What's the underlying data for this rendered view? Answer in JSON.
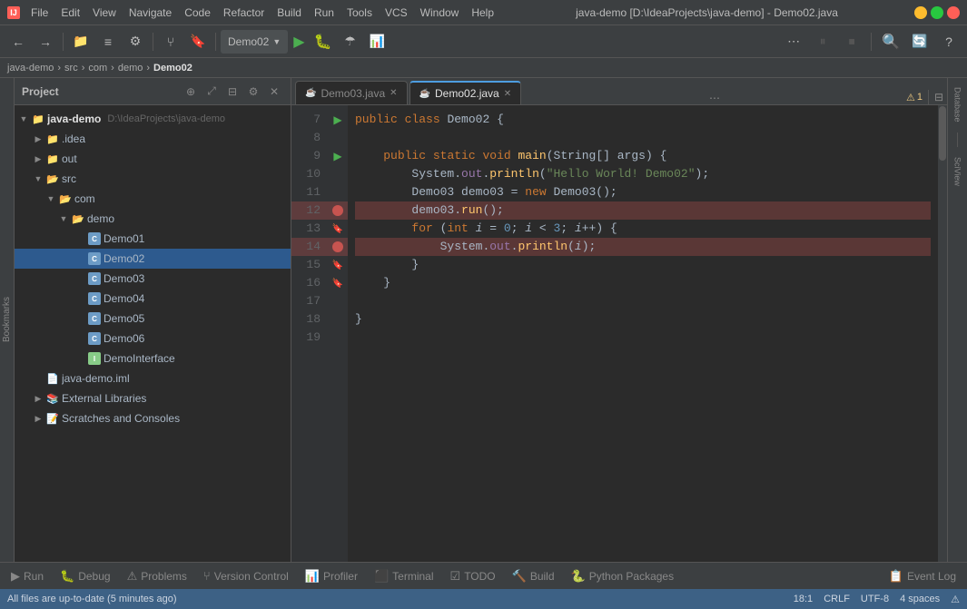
{
  "titlebar": {
    "menus": [
      "File",
      "Edit",
      "View",
      "Navigate",
      "Code",
      "Refactor",
      "Build",
      "Run",
      "Tools",
      "VCS",
      "Window",
      "Help"
    ],
    "title": "java-demo [D:\\IdeaProjects\\java-demo] - Demo02.java",
    "app_icon": "IJ"
  },
  "breadcrumb": {
    "items": [
      "java-demo",
      "src",
      "com",
      "demo",
      "Demo02"
    ]
  },
  "toolbar": {
    "run_config": "Demo02",
    "run_label": "▶",
    "debug_label": "🐛"
  },
  "project_panel": {
    "title": "Project",
    "root": {
      "label": "java-demo",
      "path": "D:\\IdeaProjects\\java-demo",
      "children": [
        {
          "label": ".idea",
          "type": "folder",
          "expanded": false
        },
        {
          "label": "out",
          "type": "folder",
          "expanded": false
        },
        {
          "label": "src",
          "type": "folder",
          "expanded": true,
          "children": [
            {
              "label": "com",
              "type": "folder",
              "expanded": true,
              "children": [
                {
                  "label": "demo",
                  "type": "folder",
                  "expanded": true,
                  "children": [
                    {
                      "label": "Demo01",
                      "type": "class"
                    },
                    {
                      "label": "Demo02",
                      "type": "class",
                      "selected": true
                    },
                    {
                      "label": "Demo03",
                      "type": "class"
                    },
                    {
                      "label": "Demo04",
                      "type": "class"
                    },
                    {
                      "label": "Demo05",
                      "type": "class"
                    },
                    {
                      "label": "Demo06",
                      "type": "class"
                    },
                    {
                      "label": "DemoInterface",
                      "type": "interface"
                    }
                  ]
                }
              ]
            }
          ]
        },
        {
          "label": "java-demo.iml",
          "type": "iml"
        },
        {
          "label": "External Libraries",
          "type": "ext",
          "expanded": false
        },
        {
          "label": "Scratches and Consoles",
          "type": "scratch",
          "expanded": false
        }
      ]
    }
  },
  "editor": {
    "tabs": [
      {
        "label": "Demo03.java",
        "active": false,
        "modified": false
      },
      {
        "label": "Demo02.java",
        "active": true,
        "modified": false
      }
    ],
    "lines": [
      {
        "num": "8",
        "content": "",
        "indent": 0
      },
      {
        "num": "9",
        "content": "    public static void main(String[] args) {",
        "hasRunArrow": true,
        "hasBookmark": true
      },
      {
        "num": "10",
        "content": "        System.out.println(\"Hello World! Demo02\");"
      },
      {
        "num": "11",
        "content": "        Demo03 demo03 = new Demo03();"
      },
      {
        "num": "12",
        "content": "        demo03.run();",
        "hasBreakpoint": true
      },
      {
        "num": "13",
        "content": "        for (int i = 0; i < 3; i++) {",
        "hasBookmark": true
      },
      {
        "num": "14",
        "content": "            System.out.println(i);",
        "hasBreakpoint": true
      },
      {
        "num": "15",
        "content": "        }",
        "hasBookmark": true
      },
      {
        "num": "16",
        "content": "    }",
        "hasBookmark": true
      },
      {
        "num": "17",
        "content": ""
      },
      {
        "num": "18",
        "content": "}"
      },
      {
        "num": "19",
        "content": ""
      }
    ],
    "header_line": {
      "num": "7",
      "content": "    public class Demo02 {",
      "hasRunArrow": true
    }
  },
  "bottom_tabs": [
    {
      "label": "Run",
      "icon": "▶"
    },
    {
      "label": "Debug",
      "icon": "🐛"
    },
    {
      "label": "Problems",
      "icon": "⚠"
    },
    {
      "label": "Version Control",
      "icon": "⑂"
    },
    {
      "label": "Profiler",
      "icon": "📊"
    },
    {
      "label": "Terminal",
      "icon": "⬛"
    },
    {
      "label": "TODO",
      "icon": "☑"
    },
    {
      "label": "Build",
      "icon": "🔨"
    },
    {
      "label": "Python Packages",
      "icon": "🐍"
    },
    {
      "label": "Event Log",
      "icon": "📋"
    }
  ],
  "status_bar": {
    "left": "All files are up-to-date (5 minutes ago)",
    "position": "18:1",
    "line_sep": "CRLF",
    "encoding": "UTF-8",
    "indent": "4 spaces",
    "warning": "⚠ 1"
  },
  "right_sidebar_tabs": [
    "Database",
    "SciView"
  ],
  "colors": {
    "accent": "#4d9de0",
    "breakpoint": "#c75450",
    "run_arrow": "#4caf50",
    "keyword": "#cc7832",
    "string": "#6a8759",
    "number": "#6897bb",
    "method": "#ffc66d"
  }
}
